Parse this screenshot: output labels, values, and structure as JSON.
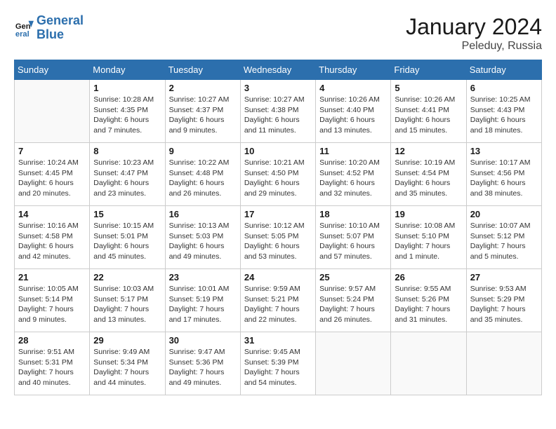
{
  "logo": {
    "line1": "General",
    "line2": "Blue"
  },
  "title": "January 2024",
  "location": "Peleduy, Russia",
  "days_header": [
    "Sunday",
    "Monday",
    "Tuesday",
    "Wednesday",
    "Thursday",
    "Friday",
    "Saturday"
  ],
  "weeks": [
    [
      {
        "day": "",
        "info": ""
      },
      {
        "day": "1",
        "info": "Sunrise: 10:28 AM\nSunset: 4:35 PM\nDaylight: 6 hours\nand 7 minutes."
      },
      {
        "day": "2",
        "info": "Sunrise: 10:27 AM\nSunset: 4:37 PM\nDaylight: 6 hours\nand 9 minutes."
      },
      {
        "day": "3",
        "info": "Sunrise: 10:27 AM\nSunset: 4:38 PM\nDaylight: 6 hours\nand 11 minutes."
      },
      {
        "day": "4",
        "info": "Sunrise: 10:26 AM\nSunset: 4:40 PM\nDaylight: 6 hours\nand 13 minutes."
      },
      {
        "day": "5",
        "info": "Sunrise: 10:26 AM\nSunset: 4:41 PM\nDaylight: 6 hours\nand 15 minutes."
      },
      {
        "day": "6",
        "info": "Sunrise: 10:25 AM\nSunset: 4:43 PM\nDaylight: 6 hours\nand 18 minutes."
      }
    ],
    [
      {
        "day": "7",
        "info": "Sunrise: 10:24 AM\nSunset: 4:45 PM\nDaylight: 6 hours\nand 20 minutes."
      },
      {
        "day": "8",
        "info": "Sunrise: 10:23 AM\nSunset: 4:47 PM\nDaylight: 6 hours\nand 23 minutes."
      },
      {
        "day": "9",
        "info": "Sunrise: 10:22 AM\nSunset: 4:48 PM\nDaylight: 6 hours\nand 26 minutes."
      },
      {
        "day": "10",
        "info": "Sunrise: 10:21 AM\nSunset: 4:50 PM\nDaylight: 6 hours\nand 29 minutes."
      },
      {
        "day": "11",
        "info": "Sunrise: 10:20 AM\nSunset: 4:52 PM\nDaylight: 6 hours\nand 32 minutes."
      },
      {
        "day": "12",
        "info": "Sunrise: 10:19 AM\nSunset: 4:54 PM\nDaylight: 6 hours\nand 35 minutes."
      },
      {
        "day": "13",
        "info": "Sunrise: 10:17 AM\nSunset: 4:56 PM\nDaylight: 6 hours\nand 38 minutes."
      }
    ],
    [
      {
        "day": "14",
        "info": "Sunrise: 10:16 AM\nSunset: 4:58 PM\nDaylight: 6 hours\nand 42 minutes."
      },
      {
        "day": "15",
        "info": "Sunrise: 10:15 AM\nSunset: 5:01 PM\nDaylight: 6 hours\nand 45 minutes."
      },
      {
        "day": "16",
        "info": "Sunrise: 10:13 AM\nSunset: 5:03 PM\nDaylight: 6 hours\nand 49 minutes."
      },
      {
        "day": "17",
        "info": "Sunrise: 10:12 AM\nSunset: 5:05 PM\nDaylight: 6 hours\nand 53 minutes."
      },
      {
        "day": "18",
        "info": "Sunrise: 10:10 AM\nSunset: 5:07 PM\nDaylight: 6 hours\nand 57 minutes."
      },
      {
        "day": "19",
        "info": "Sunrise: 10:08 AM\nSunset: 5:10 PM\nDaylight: 7 hours\nand 1 minute."
      },
      {
        "day": "20",
        "info": "Sunrise: 10:07 AM\nSunset: 5:12 PM\nDaylight: 7 hours\nand 5 minutes."
      }
    ],
    [
      {
        "day": "21",
        "info": "Sunrise: 10:05 AM\nSunset: 5:14 PM\nDaylight: 7 hours\nand 9 minutes."
      },
      {
        "day": "22",
        "info": "Sunrise: 10:03 AM\nSunset: 5:17 PM\nDaylight: 7 hours\nand 13 minutes."
      },
      {
        "day": "23",
        "info": "Sunrise: 10:01 AM\nSunset: 5:19 PM\nDaylight: 7 hours\nand 17 minutes."
      },
      {
        "day": "24",
        "info": "Sunrise: 9:59 AM\nSunset: 5:21 PM\nDaylight: 7 hours\nand 22 minutes."
      },
      {
        "day": "25",
        "info": "Sunrise: 9:57 AM\nSunset: 5:24 PM\nDaylight: 7 hours\nand 26 minutes."
      },
      {
        "day": "26",
        "info": "Sunrise: 9:55 AM\nSunset: 5:26 PM\nDaylight: 7 hours\nand 31 minutes."
      },
      {
        "day": "27",
        "info": "Sunrise: 9:53 AM\nSunset: 5:29 PM\nDaylight: 7 hours\nand 35 minutes."
      }
    ],
    [
      {
        "day": "28",
        "info": "Sunrise: 9:51 AM\nSunset: 5:31 PM\nDaylight: 7 hours\nand 40 minutes."
      },
      {
        "day": "29",
        "info": "Sunrise: 9:49 AM\nSunset: 5:34 PM\nDaylight: 7 hours\nand 44 minutes."
      },
      {
        "day": "30",
        "info": "Sunrise: 9:47 AM\nSunset: 5:36 PM\nDaylight: 7 hours\nand 49 minutes."
      },
      {
        "day": "31",
        "info": "Sunrise: 9:45 AM\nSunset: 5:39 PM\nDaylight: 7 hours\nand 54 minutes."
      },
      {
        "day": "",
        "info": ""
      },
      {
        "day": "",
        "info": ""
      },
      {
        "day": "",
        "info": ""
      }
    ]
  ]
}
